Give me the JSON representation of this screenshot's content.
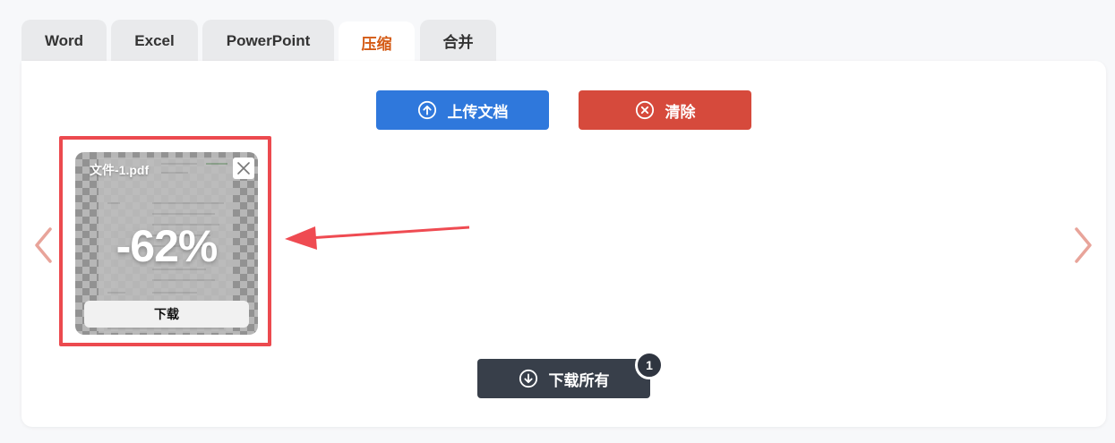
{
  "tabs": [
    {
      "label": "Word",
      "active": false
    },
    {
      "label": "Excel",
      "active": false
    },
    {
      "label": "PowerPoint",
      "active": false
    },
    {
      "label": "压缩",
      "active": true
    },
    {
      "label": "合并",
      "active": false
    }
  ],
  "toolbar": {
    "upload_label": "上传文档",
    "clear_label": "清除"
  },
  "files": [
    {
      "name": "文件-1.pdf",
      "reduction": "-62%",
      "download_label": "下载"
    }
  ],
  "footer": {
    "download_all_label": "下载所有",
    "file_count": "1"
  },
  "colors": {
    "active_tab_text": "#d45a14",
    "upload_button": "#2f78dc",
    "clear_button": "#d64a3c",
    "download_all_button": "#383f4a",
    "highlight": "#ec4a4f",
    "nav_arrow": "#e8a49a"
  },
  "icons": {
    "upload": "arrow-up-circle-icon",
    "clear": "x-circle-icon",
    "download_all": "arrow-down-circle-icon",
    "card_close": "close-icon",
    "prev": "chevron-left-icon",
    "next": "chevron-right-icon"
  }
}
